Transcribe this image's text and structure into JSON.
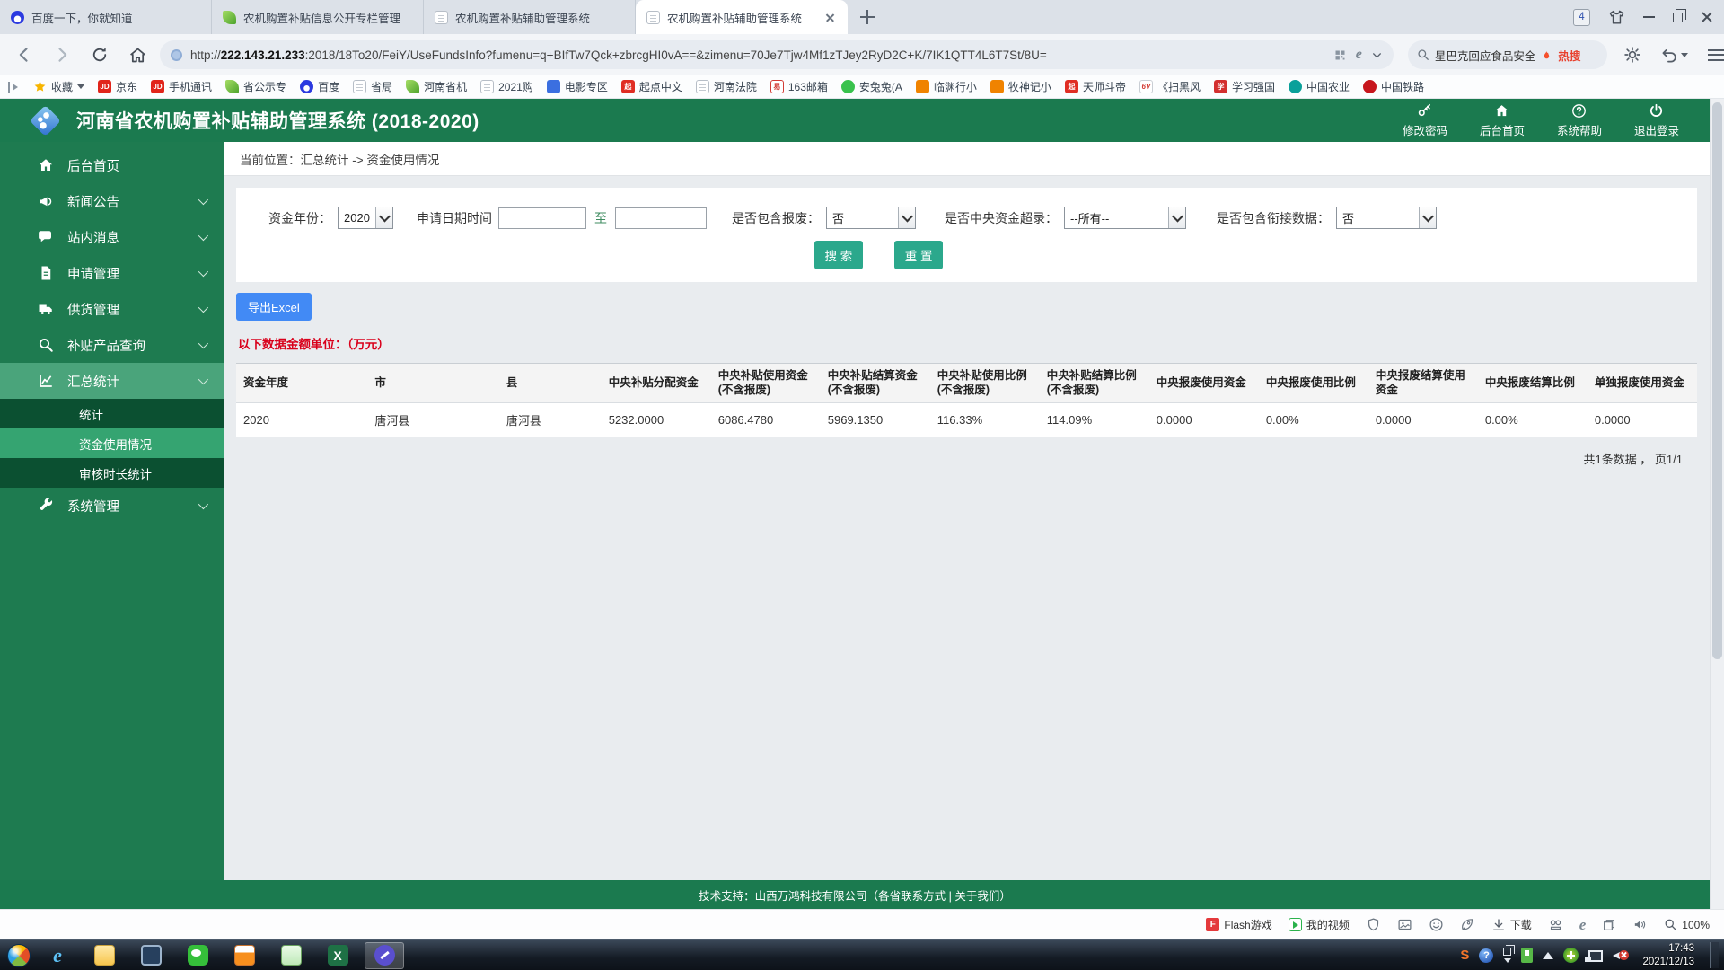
{
  "colors": {
    "theme_green": "#1b7a4f",
    "menu_open_green": "#4aa47b",
    "submenu_dark_green": "#0b5031",
    "submenu_selected_green": "#35a471",
    "button_teal": "#2ba88c",
    "button_blue": "#428af5",
    "note_red": "#d9001b"
  },
  "browser": {
    "tabs": [
      {
        "title": "百度一下，你就知道",
        "icon": "baidu"
      },
      {
        "title": "农机购置补贴信息公开专栏管理",
        "icon": "leaf"
      },
      {
        "title": "农机购置补贴辅助管理系统",
        "icon": "page"
      },
      {
        "title": "农机购置补贴辅助管理系统",
        "icon": "page"
      }
    ],
    "window_count": "4",
    "url": {
      "protocol": "http://",
      "host": "222.143.21.233",
      "rest": ":2018/18To20/FeiY/UseFundsInfo?fumenu=q+BIfTw7Qck+zbrcgHI0vA==&zimenu=70Je7Tjw4Mf1zTJey2RyD2C+K/7IK1QTT4L6T7St/8U="
    },
    "search": {
      "query": "星巴克回应食品安全",
      "hot_label": "热搜"
    },
    "ie_glyph": "e"
  },
  "bookmarks": {
    "favorites_label": "收藏",
    "items": [
      {
        "label": "京东",
        "icon": "jd",
        "glyph": "JD"
      },
      {
        "label": "手机通讯",
        "icon": "jd",
        "glyph": "JD"
      },
      {
        "label": "省公示专",
        "icon": "leaf",
        "glyph": ""
      },
      {
        "label": "百度",
        "icon": "baidu",
        "glyph": ""
      },
      {
        "label": "省局",
        "icon": "page",
        "glyph": ""
      },
      {
        "label": "河南省机",
        "icon": "leaf",
        "glyph": ""
      },
      {
        "label": "2021购",
        "icon": "page",
        "glyph": ""
      },
      {
        "label": "电影专区",
        "icon": "movie",
        "glyph": ""
      },
      {
        "label": "起点中文",
        "icon": "qidian",
        "glyph": "起"
      },
      {
        "label": "河南法院",
        "icon": "page",
        "glyph": ""
      },
      {
        "label": "163邮箱",
        "icon": "mail163",
        "glyph": "易"
      },
      {
        "label": "安兔兔(A",
        "icon": "antutu",
        "glyph": ""
      },
      {
        "label": "临渊行小",
        "icon": "book",
        "glyph": ""
      },
      {
        "label": "牧神记小",
        "icon": "book",
        "glyph": ""
      },
      {
        "label": "天师斗帝",
        "icon": "qidian",
        "glyph": "起"
      },
      {
        "label": "《扫黑风",
        "icon": "v6",
        "glyph": "6V"
      },
      {
        "label": "学习强国",
        "icon": "xuexi",
        "glyph": "学"
      },
      {
        "label": "中国农业",
        "icon": "agri",
        "glyph": ""
      },
      {
        "label": "中国铁路",
        "icon": "railway",
        "glyph": ""
      }
    ]
  },
  "app": {
    "title": "河南省农机购置补贴辅助管理系统 (2018-2020)",
    "actions": [
      {
        "label": "修改密码"
      },
      {
        "label": "后台首页"
      },
      {
        "label": "系统帮助"
      },
      {
        "label": "退出登录"
      }
    ]
  },
  "sidebar": {
    "items": [
      {
        "label": "后台首页"
      },
      {
        "label": "新闻公告"
      },
      {
        "label": "站内消息"
      },
      {
        "label": "申请管理"
      },
      {
        "label": "供货管理"
      },
      {
        "label": "补贴产品查询"
      },
      {
        "label": "汇总统计"
      },
      {
        "label": "系统管理"
      }
    ],
    "submenu": [
      {
        "label": "统计"
      },
      {
        "label": "资金使用情况"
      },
      {
        "label": "审核时长统计"
      }
    ]
  },
  "main": {
    "breadcrumb": "当前位置：汇总统计 -> 资金使用情况",
    "filters": {
      "year_label": "资金年份：",
      "year_value": "2020",
      "date_label": "申请日期时间",
      "date_from_value": "",
      "date_to_word": "至",
      "date_to_value": "",
      "scrap_label": "是否包含报废：",
      "scrap_value": "否",
      "central_label": "是否中央资金超录：",
      "central_value": "--所有--",
      "link_label": "是否包含衔接数据：",
      "link_value": "否"
    },
    "search_button": "搜 索",
    "reset_button": "重 置",
    "export_button": "导出Excel",
    "unit_note": "以下数据金额单位：（万元）",
    "table": {
      "headers": [
        "资金年度",
        "市",
        "县",
        "中央补贴分配资金",
        "中央补贴使用资金(不含报废)",
        "中央补贴结算资金(不含报废)",
        "中央补贴使用比例(不含报废)",
        "中央补贴结算比例(不含报废)",
        "中央报废使用资金",
        "中央报废使用比例",
        "中央报废结算使用资金",
        "中央报废结算比例",
        "单独报废使用资金"
      ],
      "rows": [
        [
          "2020",
          "唐河县",
          "唐河县",
          "5232.0000",
          "6086.4780",
          "5969.1350",
          "116.33%",
          "114.09%",
          "0.0000",
          "0.00%",
          "0.0000",
          "0.00%",
          "0.0000"
        ]
      ],
      "summary": "共1条数据 ， 页1/1"
    }
  },
  "footer": {
    "text": "技术支持：山西万鸿科技有限公司（各省联系方式 | 关于我们）"
  },
  "statusbar": {
    "flash_glyph": "F",
    "flash": "Flash游戏",
    "video": "我的视频",
    "download": "下载",
    "zoom": "100%",
    "ie_glyph": "e"
  },
  "taskbar": {
    "sogou_glyph": "S",
    "help_glyph": "?",
    "excel_glyph": "X",
    "time": "17:43",
    "date": "2021/12/13"
  }
}
